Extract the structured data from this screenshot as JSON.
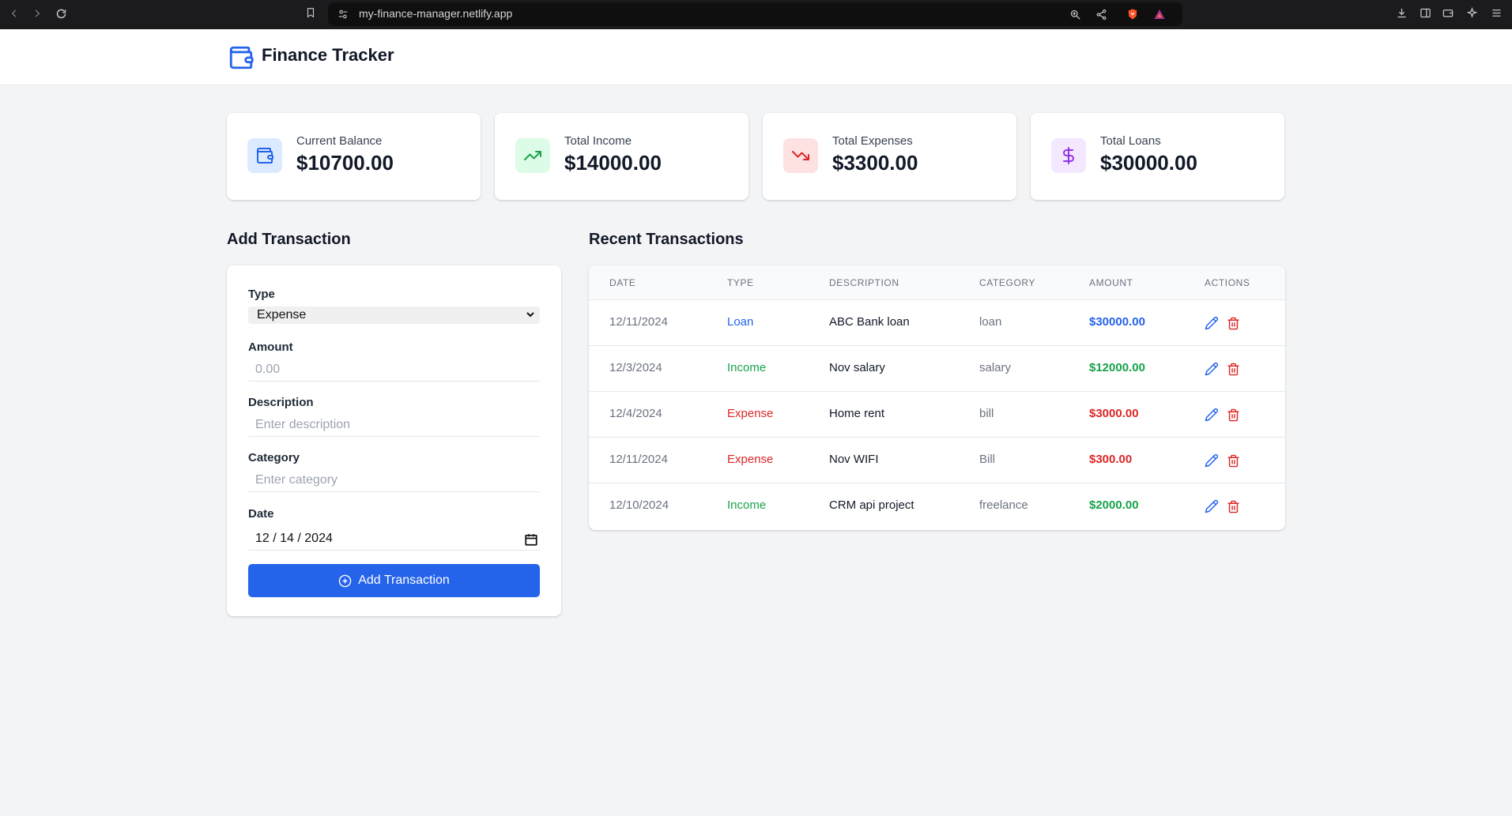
{
  "browser": {
    "url": "my-finance-manager.netlify.app"
  },
  "app": {
    "title": "Finance Tracker",
    "accent_color": "#2563eb"
  },
  "stats": [
    {
      "label": "Current Balance",
      "value": "$10700.00",
      "icon": "wallet-icon",
      "color": "#2563eb",
      "bg": "#dbeafe"
    },
    {
      "label": "Total Income",
      "value": "$14000.00",
      "icon": "trending-up-icon",
      "color": "#16a34a",
      "bg": "#dcfce7"
    },
    {
      "label": "Total Expenses",
      "value": "$3300.00",
      "icon": "trending-down-icon",
      "color": "#dc2626",
      "bg": "#fee2e2"
    },
    {
      "label": "Total Loans",
      "value": "$30000.00",
      "icon": "dollar-icon",
      "color": "#9333ea",
      "bg": "#f3e8ff"
    }
  ],
  "form": {
    "title": "Add Transaction",
    "type_label": "Type",
    "type_value": "Expense",
    "amount_label": "Amount",
    "amount_placeholder": "0.00",
    "description_label": "Description",
    "description_placeholder": "Enter description",
    "category_label": "Category",
    "category_placeholder": "Enter category",
    "date_label": "Date",
    "date_value": "12 / 14 / 2024",
    "submit_label": "Add Transaction"
  },
  "transactions": {
    "title": "Recent Transactions",
    "headers": [
      "DATE",
      "TYPE",
      "DESCRIPTION",
      "CATEGORY",
      "AMOUNT",
      "ACTIONS"
    ],
    "rows": [
      {
        "date": "12/11/2024",
        "type": "Loan",
        "description": "ABC Bank loan",
        "category": "loan",
        "amount": "$30000.00"
      },
      {
        "date": "12/3/2024",
        "type": "Income",
        "description": "Nov salary",
        "category": "salary",
        "amount": "$12000.00"
      },
      {
        "date": "12/4/2024",
        "type": "Expense",
        "description": "Home rent",
        "category": "bill",
        "amount": "$3000.00"
      },
      {
        "date": "12/11/2024",
        "type": "Expense",
        "description": "Nov WIFI",
        "category": "Bill",
        "amount": "$300.00"
      },
      {
        "date": "12/10/2024",
        "type": "Income",
        "description": "CRM api project",
        "category": "freelance",
        "amount": "$2000.00"
      }
    ],
    "type_colors": {
      "Loan": "#2563eb",
      "Income": "#16a34a",
      "Expense": "#dc2626"
    }
  }
}
